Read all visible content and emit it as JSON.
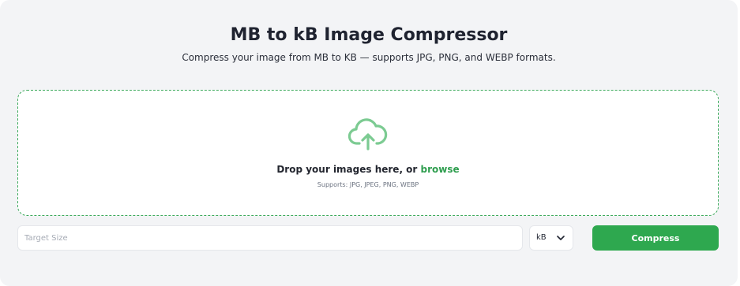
{
  "header": {
    "title": "MB to kB Image Compressor",
    "subtitle": "Compress your image from MB to KB — supports JPG, PNG, and WEBP formats."
  },
  "dropzone": {
    "icon": "cloud-upload-icon",
    "prompt_text": "Drop your images here, or ",
    "browse_label": "browse",
    "supports_text": "Supports: JPG, JPEG, PNG, WEBP"
  },
  "controls": {
    "target_size_placeholder": "Target Size",
    "target_size_value": "",
    "unit_selected": "kB",
    "compress_label": "Compress"
  },
  "colors": {
    "accent": "#2ea84f",
    "icon": "#7ccb92",
    "background": "#f3f4f6"
  }
}
